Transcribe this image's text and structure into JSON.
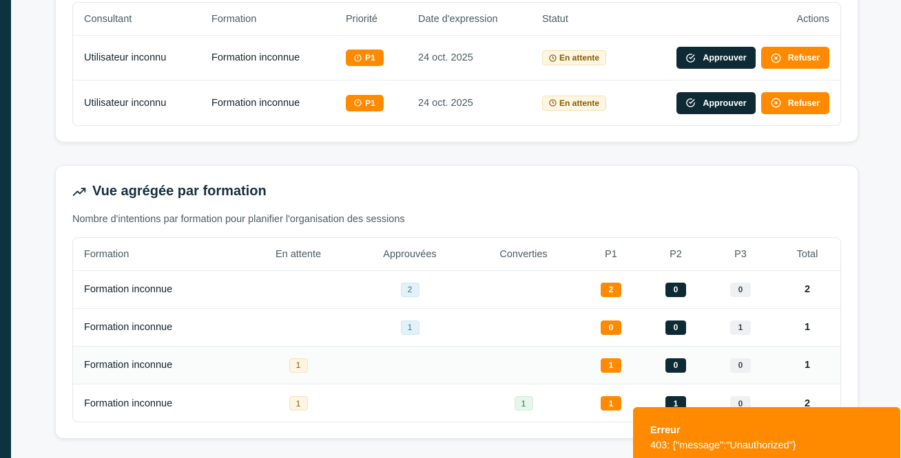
{
  "colors": {
    "sidebar": "#0d3340",
    "primary_dark": "#0d2a35",
    "accent_orange": "#ff8a00",
    "toast_bg": "#ff8a00"
  },
  "requests_table": {
    "headers": {
      "consultant": "Consultant",
      "formation": "Formation",
      "priority": "Priorité",
      "date": "Date d'expression",
      "status": "Statut",
      "actions": "Actions"
    },
    "rows": [
      {
        "consultant": "Utilisateur inconnu",
        "formation": "Formation inconnue",
        "priority": "P1",
        "date": "24 oct. 2025",
        "status": "En attente",
        "approve_label": "Approuver",
        "refuse_label": "Refuser"
      },
      {
        "consultant": "Utilisateur inconnu",
        "formation": "Formation inconnue",
        "priority": "P1",
        "date": "24 oct. 2025",
        "status": "En attente",
        "approve_label": "Approuver",
        "refuse_label": "Refuser"
      }
    ]
  },
  "aggregate": {
    "title": "Vue agrégée par formation",
    "title_icon": "trending-up-icon",
    "subtitle": "Nombre d'intentions par formation pour planifier l'organisation des sessions",
    "headers": {
      "formation": "Formation",
      "pending": "En attente",
      "approved": "Approuvées",
      "converted": "Converties",
      "p1": "P1",
      "p2": "P2",
      "p3": "P3",
      "total": "Total"
    },
    "rows": [
      {
        "formation": "Formation inconnue",
        "pending": "",
        "approved": "2",
        "converted": "",
        "p1": "2",
        "p2": "0",
        "p3": "0",
        "total": "2"
      },
      {
        "formation": "Formation inconnue",
        "pending": "",
        "approved": "1",
        "converted": "",
        "p1": "0",
        "p2": "0",
        "p3": "1",
        "total": "1"
      },
      {
        "formation": "Formation inconnue",
        "pending": "1",
        "approved": "",
        "converted": "",
        "p1": "1",
        "p2": "0",
        "p3": "0",
        "total": "1"
      },
      {
        "formation": "Formation inconnue",
        "pending": "1",
        "approved": "",
        "converted": "1",
        "p1": "1",
        "p2": "1",
        "p3": "0",
        "total": "2"
      }
    ]
  },
  "toast": {
    "title": "Erreur",
    "message": "403: {\"message\":\"Unauthorized\"}"
  }
}
